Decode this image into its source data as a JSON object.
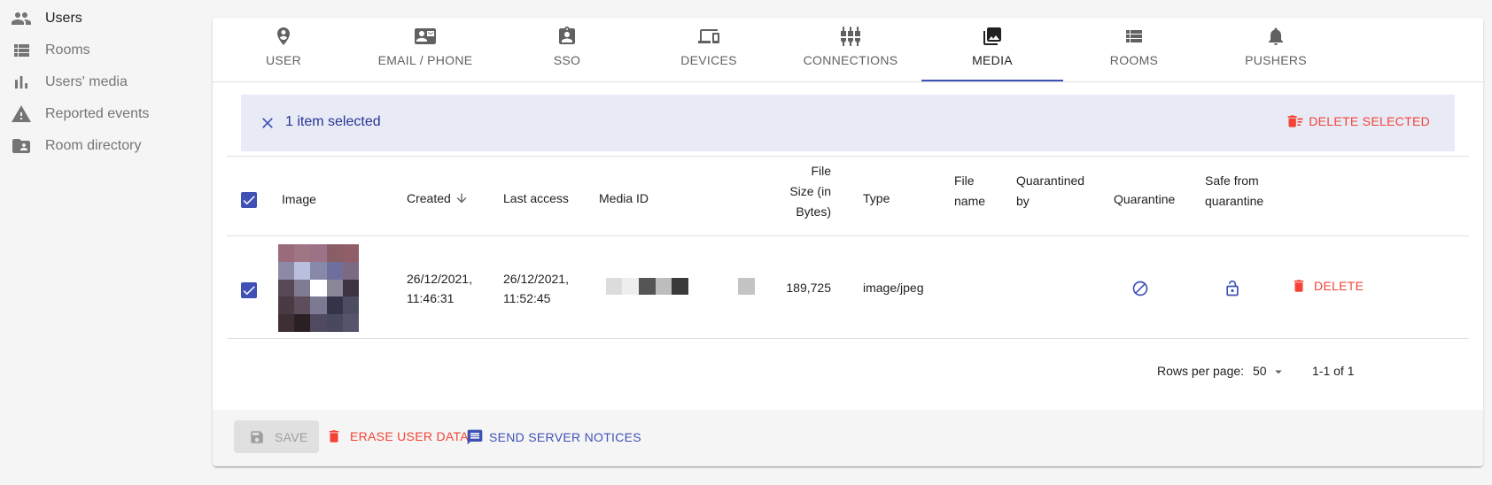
{
  "sidebar": {
    "items": [
      {
        "label": "Users",
        "icon": "people-icon",
        "active": true
      },
      {
        "label": "Rooms",
        "icon": "list-icon",
        "active": false
      },
      {
        "label": "Users' media",
        "icon": "bar-chart-icon",
        "active": false
      },
      {
        "label": "Reported events",
        "icon": "warning-icon",
        "active": false
      },
      {
        "label": "Room directory",
        "icon": "folder-shared-icon",
        "active": false
      }
    ]
  },
  "tabs": [
    {
      "label": "USER",
      "icon": "person-pin-icon"
    },
    {
      "label": "EMAIL / PHONE",
      "icon": "contact-mail-icon"
    },
    {
      "label": "SSO",
      "icon": "assignment-ind-icon"
    },
    {
      "label": "DEVICES",
      "icon": "devices-icon"
    },
    {
      "label": "CONNECTIONS",
      "icon": "settings-input-component-icon"
    },
    {
      "label": "MEDIA",
      "icon": "photo-library-icon",
      "active": true
    },
    {
      "label": "ROOMS",
      "icon": "view-list-icon"
    },
    {
      "label": "PUSHERS",
      "icon": "notifications-icon"
    }
  ],
  "selection": {
    "text": "1 item selected",
    "delete_selected_label": "DELETE SELECTED"
  },
  "table": {
    "headers": {
      "image": "Image",
      "created": "Created",
      "last_access": "Last access",
      "media_id": "Media ID",
      "file_size_line1": "File",
      "file_size_line2": "Size (in",
      "file_size_line3": "Bytes)",
      "type": "Type",
      "file_name_line1": "File",
      "file_name_line2": "name",
      "quarantined_by_line1": "Quarantined",
      "quarantined_by_line2": "by",
      "quarantine": "Quarantine",
      "safe_line1": "Safe from",
      "safe_line2": "quarantine"
    },
    "rows": [
      {
        "selected": true,
        "created_line1": "26/12/2021,",
        "created_line2": "11:46:31",
        "last_access_line1": "26/12/2021,",
        "last_access_line2": "11:52:45",
        "file_size": "189,725",
        "type": "image/jpeg",
        "file_name": "",
        "quarantined_by": "",
        "delete_label": "DELETE"
      }
    ]
  },
  "pagination": {
    "rows_per_page_label": "Rows per page:",
    "rows_per_page_value": "50",
    "range": "1-1 of 1"
  },
  "footer": {
    "save_label": "SAVE",
    "erase_label": "ERASE USER DATA",
    "notice_label": "SEND SERVER NOTICES"
  },
  "colors": {
    "primary": "#3f51b5",
    "danger": "#f44336",
    "selection_bg": "#e8eaf6"
  }
}
